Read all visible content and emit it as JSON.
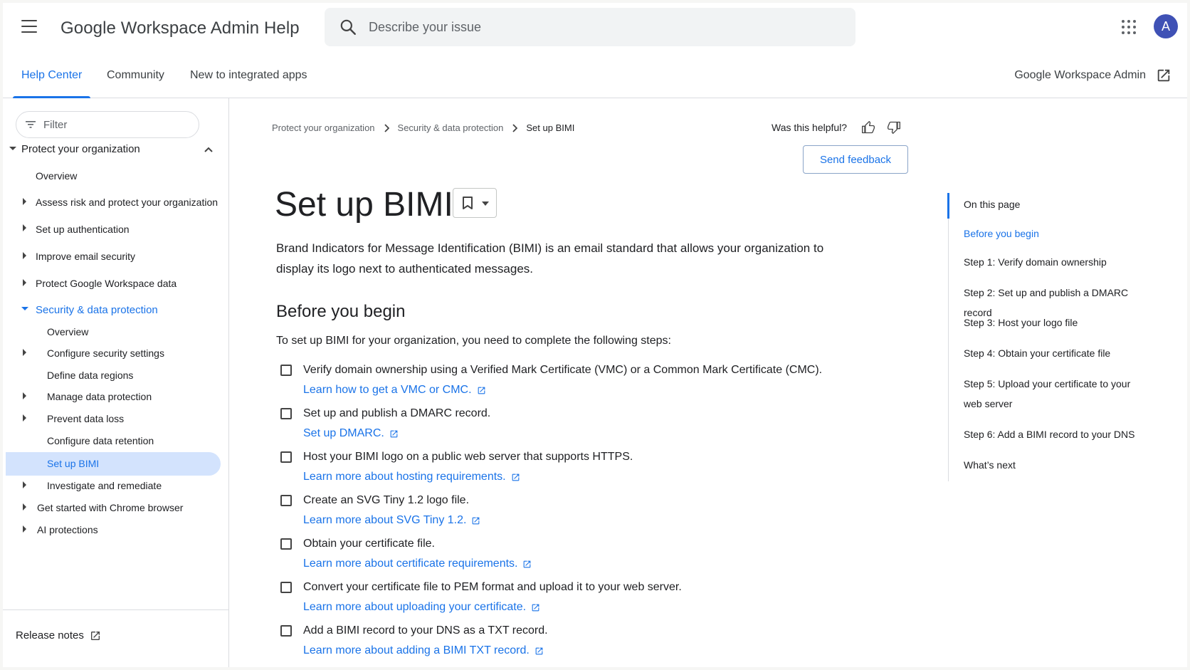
{
  "header": {
    "brand": "Google Workspace Admin Help",
    "search_placeholder": "Describe your issue",
    "avatar_letter": "A"
  },
  "tabs": [
    {
      "label": "Help Center",
      "active": true
    },
    {
      "label": "Community",
      "active": false
    },
    {
      "label": "New to integrated apps",
      "active": false
    }
  ],
  "admin_link": "Google Workspace Admin",
  "sidebar": {
    "filter_placeholder": "Filter",
    "items": [
      "Protect your organization",
      "Overview",
      "Assess risk and protect your organization",
      "Set up authentication",
      "Improve email security",
      "Protect Google Workspace data",
      "Security & data protection",
      "Overview",
      "Configure security settings",
      "Define data regions",
      "Manage data protection",
      "Prevent data loss",
      "Configure data retention",
      "Set up BIMI",
      "Investigate and remediate",
      "Get started with Chrome browser",
      "AI protections"
    ],
    "release_notes": "Release notes"
  },
  "breadcrumb": [
    "Protect your organization",
    "Security & data protection",
    "Set up BIMI"
  ],
  "feedback": {
    "question": "Was this helpful?",
    "button": "Send feedback"
  },
  "article": {
    "title": "Set up BIMI",
    "intro": "Brand Indicators for Message Identification (BIMI) is an email standard that allows your organization to display its logo next to authenticated messages.",
    "section_title": "Before you begin",
    "steps_intro": "To set up BIMI for your organization, you need to complete the following steps:",
    "steps": [
      {
        "text": "Verify domain ownership using a Verified Mark Certificate (VMC) or a Common Mark Certificate (CMC).",
        "link": "Learn how to get a VMC or CMC."
      },
      {
        "text": "Set up and publish a DMARC record.",
        "link": "Set up DMARC."
      },
      {
        "text": "Host your BIMI logo on a public web server that supports HTTPS.",
        "link": "Learn more about hosting requirements."
      },
      {
        "text": "Create an SVG Tiny 1.2 logo file.",
        "link": "Learn more about SVG Tiny 1.2."
      },
      {
        "text": "Obtain your certificate file.",
        "link": "Learn more about certificate requirements."
      },
      {
        "text": "Convert your certificate file to PEM format and upload it to your web server.",
        "link": "Learn more about uploading your certificate."
      },
      {
        "text": "Add a BIMI record to your DNS as a TXT record.",
        "link": "Learn more about adding a BIMI TXT record."
      }
    ]
  },
  "toc": {
    "heading": "On this page",
    "items": [
      "Before you begin",
      "Step 1: Verify domain ownership",
      "Step 2: Set up and publish a DMARC record",
      "Step 3: Host your logo file",
      "Step 4: Obtain your certificate file",
      "Step 5: Upload your certificate to your web server",
      "Step 6: Add a BIMI record to your DNS",
      "What’s next"
    ]
  },
  "colors": {
    "accent": "#1a73e8",
    "active_bg": "#d3e3fd",
    "avatar": "#3f51b5"
  }
}
